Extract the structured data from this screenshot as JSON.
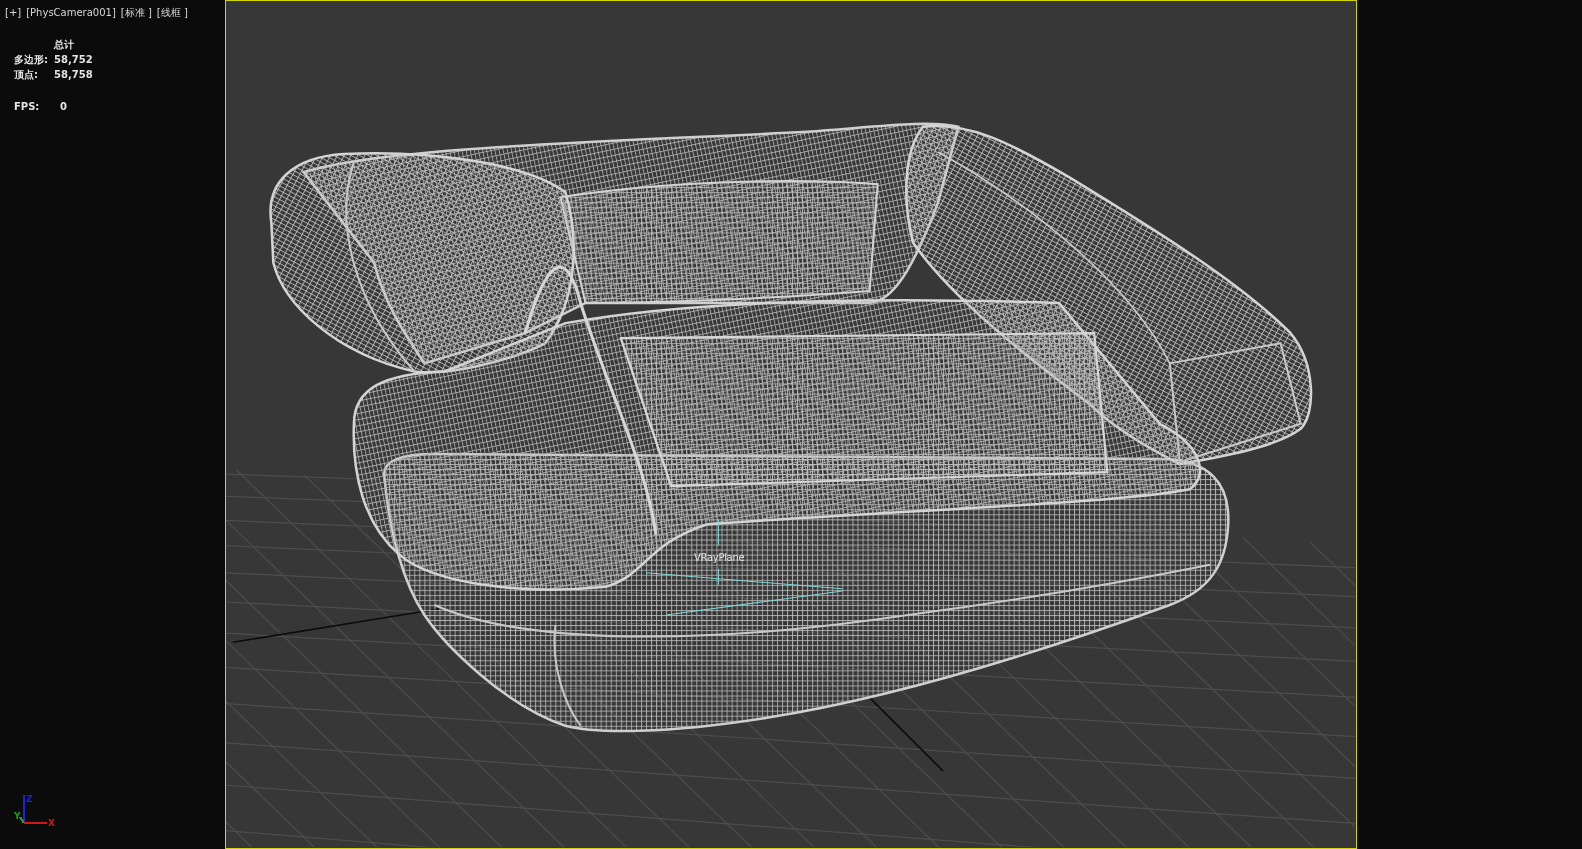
{
  "viewport": {
    "menu_label": "[+]",
    "camera_label": "[PhysCamera001]",
    "shading_label": "[标准 ]",
    "display_label": "[线框 ]"
  },
  "statistics": {
    "heading": "总计",
    "rows": [
      {
        "label": "多边形:",
        "value": "58,752"
      },
      {
        "label": "顶点:",
        "value": "58,758"
      }
    ],
    "fps": {
      "label": "FPS:",
      "value": "0"
    }
  },
  "scene": {
    "object_label": "VRayPlane"
  },
  "axis_gizmo": {
    "axes": [
      {
        "label": "Z",
        "color": "#2020e0"
      },
      {
        "label": "Y",
        "color": "#20a020"
      },
      {
        "label": "X",
        "color": "#d01818"
      }
    ]
  }
}
